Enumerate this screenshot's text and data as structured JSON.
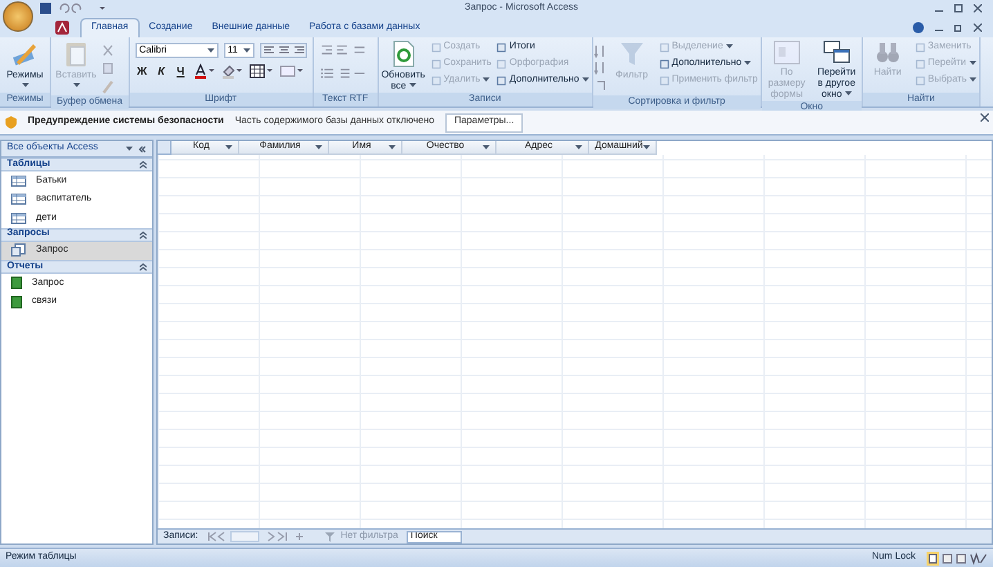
{
  "window": {
    "title": "Запрос - Microsoft Access"
  },
  "tabs": [
    {
      "label": "Главная",
      "selected": true
    },
    {
      "label": "Создание",
      "selected": false
    },
    {
      "label": "Внешние данные",
      "selected": false
    },
    {
      "label": "Работа с базами данных",
      "selected": false
    }
  ],
  "ribbon": {
    "groups": [
      {
        "label": "Режимы",
        "items": [
          {
            "kind": "large",
            "label": "Режимы",
            "disabled": false,
            "menu": true
          }
        ]
      },
      {
        "label": "Буфер обмена",
        "items": [
          {
            "kind": "large",
            "label": "Вставить",
            "disabled": true,
            "menu": true
          },
          {
            "kind": "tools"
          }
        ]
      },
      {
        "label": "Шрифт",
        "items": [
          {
            "kind": "font",
            "font": "Calibri",
            "size": "11",
            "styles": [
              "Ж",
              "К",
              "Ч"
            ]
          }
        ]
      },
      {
        "label": "Текст RTF",
        "items": [
          {
            "kind": "rtf"
          }
        ]
      },
      {
        "label": "Записи",
        "items": [
          {
            "kind": "large",
            "label": "Обновить все",
            "disabled": false,
            "menu": true
          },
          {
            "kind": "stack",
            "items": [
              {
                "label": "Создать",
                "disabled": true,
                "menu": false
              },
              {
                "label": "Сохранить",
                "disabled": true,
                "menu": false
              },
              {
                "label": "Удалить",
                "disabled": true,
                "menu": true
              }
            ]
          },
          {
            "kind": "stack",
            "items": [
              {
                "label": "Итоги",
                "disabled": false,
                "menu": false
              },
              {
                "label": "Орфография",
                "disabled": true,
                "menu": false
              },
              {
                "label": "Дополнительно",
                "disabled": false,
                "menu": true
              }
            ]
          }
        ]
      },
      {
        "label": "Сортировка и фильтр",
        "items": [
          {
            "kind": "sort"
          },
          {
            "kind": "large",
            "label": "Фильтр",
            "disabled": true,
            "menu": false
          },
          {
            "kind": "stack",
            "items": [
              {
                "label": "Выделение",
                "disabled": true,
                "menu": true
              },
              {
                "label": "Дополнительно",
                "disabled": false,
                "menu": true
              },
              {
                "label": "Применить фильтр",
                "disabled": true,
                "menu": false
              }
            ]
          }
        ]
      },
      {
        "label": "Окно",
        "items": [
          {
            "kind": "large",
            "label": "По размеру формы",
            "disabled": true,
            "menu": false
          },
          {
            "kind": "large",
            "label": "Перейти в другое окно",
            "disabled": false,
            "menu": true
          }
        ]
      },
      {
        "label": "Найти",
        "items": [
          {
            "kind": "large",
            "label": "Найти",
            "disabled": true,
            "menu": false
          },
          {
            "kind": "stack",
            "items": [
              {
                "label": "Заменить",
                "disabled": true,
                "menu": false
              },
              {
                "label": "Перейти",
                "disabled": true,
                "menu": true
              },
              {
                "label": "Выбрать",
                "disabled": true,
                "menu": true
              }
            ]
          }
        ]
      }
    ]
  },
  "security": {
    "title": "Предупреждение системы безопасности",
    "message": "Часть содержимого базы данных отключено",
    "button": "Параметры..."
  },
  "nav": {
    "header": "Все объекты Access",
    "sections": [
      {
        "label": "Таблицы",
        "items": [
          {
            "label": "Батьки",
            "kind": "table",
            "selected": false
          },
          {
            "label": "васпитатель",
            "kind": "table",
            "selected": false
          },
          {
            "label": "дети",
            "kind": "table",
            "selected": false
          }
        ]
      },
      {
        "label": "Запросы",
        "items": [
          {
            "label": "Запрос",
            "kind": "query",
            "selected": true
          }
        ]
      },
      {
        "label": "Отчеты",
        "items": [
          {
            "label": "Запрос",
            "kind": "report",
            "selected": false
          },
          {
            "label": "связи",
            "kind": "report",
            "selected": false
          }
        ]
      }
    ]
  },
  "table": {
    "columns": [
      "Код",
      "Фамилия",
      "Имя",
      "Очество",
      "Адрес",
      "Домашний"
    ]
  },
  "record_nav": {
    "label": "Записи:",
    "filter": "Нет фильтра",
    "search_placeholder": "Поиск"
  },
  "status_bar": {
    "mode": "Режим таблицы",
    "num_lock": "Num Lock"
  }
}
